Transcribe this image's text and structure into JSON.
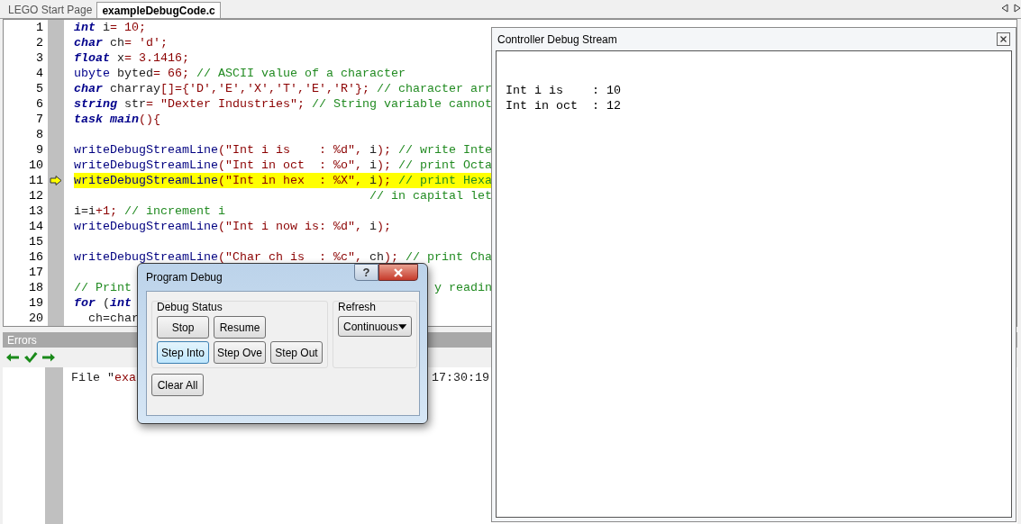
{
  "tabs": [
    {
      "label": "LEGO Start Page",
      "selected": false
    },
    {
      "label": "exampleDebugCode.c",
      "selected": true
    }
  ],
  "editor": {
    "lines": [
      {
        "number": "1",
        "current": false,
        "tokens": [
          {
            "kind": "keyword",
            "text": "int"
          },
          {
            "kind": "plain",
            "text": " i"
          },
          {
            "kind": "literal",
            "text": "= 10;"
          }
        ]
      },
      {
        "number": "2",
        "current": false,
        "tokens": [
          {
            "kind": "keyword",
            "text": "char"
          },
          {
            "kind": "plain",
            "text": " ch"
          },
          {
            "kind": "literal",
            "text": "= 'd';"
          }
        ]
      },
      {
        "number": "3",
        "current": false,
        "tokens": [
          {
            "kind": "keyword",
            "text": "float"
          },
          {
            "kind": "plain",
            "text": " x"
          },
          {
            "kind": "literal",
            "text": "= 3.1416;"
          }
        ]
      },
      {
        "number": "4",
        "current": false,
        "tokens": [
          {
            "kind": "type",
            "text": "ubyte"
          },
          {
            "kind": "plain",
            "text": " byted"
          },
          {
            "kind": "literal",
            "text": "= 66;"
          },
          {
            "kind": "comment",
            "text": " // ASCII value of a character"
          }
        ]
      },
      {
        "number": "5",
        "current": false,
        "tokens": [
          {
            "kind": "keyword",
            "text": "char"
          },
          {
            "kind": "plain",
            "text": " charray"
          },
          {
            "kind": "literal",
            "text": "[]={'D','E','X','T','E','R'};"
          },
          {
            "kind": "comment",
            "text": " // character arr"
          }
        ]
      },
      {
        "number": "6",
        "current": false,
        "tokens": [
          {
            "kind": "keyword",
            "text": "string"
          },
          {
            "kind": "plain",
            "text": " str"
          },
          {
            "kind": "literal",
            "text": "= \"Dexter Industries\";"
          },
          {
            "kind": "comment",
            "text": " // String variable cannot"
          }
        ]
      },
      {
        "number": "7",
        "current": false,
        "tokens": [
          {
            "kind": "keyword",
            "text": "task"
          },
          {
            "kind": "keyword",
            "text": " main"
          },
          {
            "kind": "literal",
            "text": "(){"
          }
        ]
      },
      {
        "number": "8",
        "current": false
      },
      {
        "number": "9",
        "current": false,
        "tokens": [
          {
            "kind": "function",
            "text": "writeDebugStreamLine"
          },
          {
            "kind": "literal",
            "text": "(\"Int i is    : %d\", "
          },
          {
            "kind": "plain",
            "text": "i"
          },
          {
            "kind": "literal",
            "text": ");"
          },
          {
            "kind": "comment",
            "text": " // write Inte"
          }
        ]
      },
      {
        "number": "10",
        "current": false,
        "tokens": [
          {
            "kind": "function",
            "text": "writeDebugStreamLine"
          },
          {
            "kind": "literal",
            "text": "(\"Int in oct  : %o\", "
          },
          {
            "kind": "plain",
            "text": "i"
          },
          {
            "kind": "literal",
            "text": ");"
          },
          {
            "kind": "comment",
            "text": " // print Octa"
          }
        ]
      },
      {
        "number": "11",
        "current": true,
        "tokens": [
          {
            "kind": "function",
            "text": "writeDebugStreamLine"
          },
          {
            "kind": "literal",
            "text": "(\"Int in hex  : %X\", "
          },
          {
            "kind": "plain",
            "text": "i"
          },
          {
            "kind": "literal",
            "text": ");"
          },
          {
            "kind": "comment",
            "text": " // print Hexa"
          }
        ]
      },
      {
        "number": "12",
        "current": false,
        "tokens": [
          {
            "kind": "comment",
            "text": "                                         // in capital let"
          }
        ]
      },
      {
        "number": "13",
        "current": false,
        "tokens": [
          {
            "kind": "plain",
            "text": "i=i"
          },
          {
            "kind": "literal",
            "text": "+1;"
          },
          {
            "kind": "comment",
            "text": " // increment i"
          }
        ]
      },
      {
        "number": "14",
        "current": false,
        "tokens": [
          {
            "kind": "function",
            "text": "writeDebugStreamLine"
          },
          {
            "kind": "literal",
            "text": "(\"Int i now is: %d\", "
          },
          {
            "kind": "plain",
            "text": "i"
          },
          {
            "kind": "literal",
            "text": ");"
          }
        ]
      },
      {
        "number": "15",
        "current": false
      },
      {
        "number": "16",
        "current": false,
        "tokens": [
          {
            "kind": "function",
            "text": "writeDebugStreamLine"
          },
          {
            "kind": "literal",
            "text": "(\"Char ch is  : %c\", "
          },
          {
            "kind": "plain",
            "text": "ch"
          },
          {
            "kind": "literal",
            "text": ");"
          },
          {
            "kind": "comment",
            "text": " // print Cha"
          }
        ]
      },
      {
        "number": "17",
        "current": false
      },
      {
        "number": "18",
        "current": false,
        "tokens": [
          {
            "kind": "comment",
            "text": "// Print"
          }
        ],
        "tail": [
          {
            "kind": "comment",
            "text": "y readin"
          }
        ]
      },
      {
        "number": "19",
        "current": false,
        "tokens": [
          {
            "kind": "keyword",
            "text": "for"
          },
          {
            "kind": "plain",
            "text": " ("
          },
          {
            "kind": "keyword",
            "text": "int"
          }
        ]
      },
      {
        "number": "20",
        "current": false,
        "tokens": [
          {
            "kind": "plain",
            "text": "  ch=char"
          }
        ]
      }
    ]
  },
  "errors": {
    "title": "Errors",
    "lines": [
      {
        "tokens": [
          {
            "kind": "plain",
            "text": "File \""
          },
          {
            "kind": "literal",
            "text": "exa"
          }
        ],
        "tail": [
          {
            "kind": "plain",
            "text": "17:30:19"
          }
        ]
      }
    ]
  },
  "debug_stream": {
    "title": "Controller Debug Stream",
    "lines": [
      "Int i is    : 10",
      "Int in oct  : 12"
    ]
  },
  "program_debug": {
    "title": "Program Debug",
    "help": "?",
    "status_group": {
      "title": "Debug Status",
      "buttons": [
        {
          "label": "Stop",
          "focused": false
        },
        {
          "label": "Resume",
          "focused": false
        },
        {
          "label": "Step Into",
          "focused": true
        },
        {
          "label": "Step Ove",
          "focused": false
        },
        {
          "label": "Step Out",
          "focused": false
        }
      ]
    },
    "clear_button": "Clear All",
    "refresh_group": {
      "title": "Refresh",
      "value": "Continuous"
    }
  }
}
